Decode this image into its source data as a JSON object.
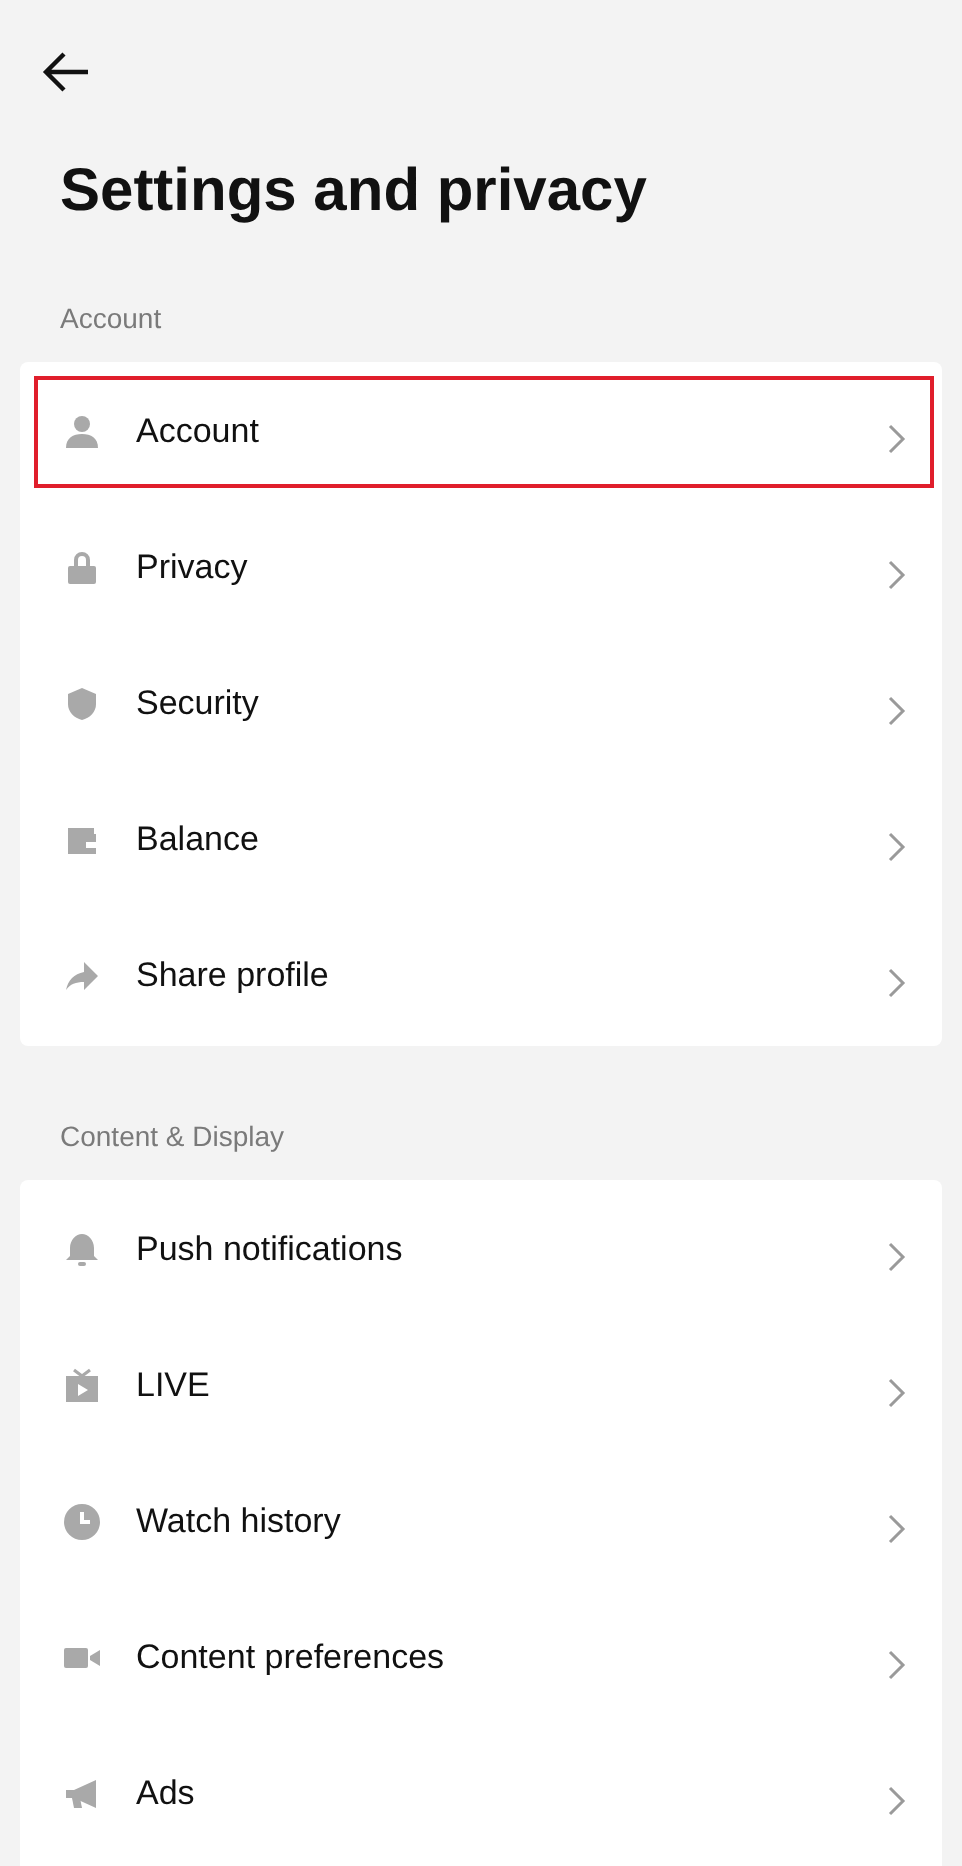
{
  "title": "Settings and privacy",
  "sections": [
    {
      "label": "Account",
      "items": [
        {
          "label": "Account",
          "highlighted": true
        },
        {
          "label": "Privacy",
          "highlighted": false
        },
        {
          "label": "Security",
          "highlighted": false
        },
        {
          "label": "Balance",
          "highlighted": false
        },
        {
          "label": "Share profile",
          "highlighted": false
        }
      ]
    },
    {
      "label": "Content & Display",
      "items": [
        {
          "label": "Push notifications",
          "highlighted": false
        },
        {
          "label": "LIVE",
          "highlighted": false
        },
        {
          "label": "Watch history",
          "highlighted": false
        },
        {
          "label": "Content preferences",
          "highlighted": false
        },
        {
          "label": "Ads",
          "highlighted": false
        }
      ]
    }
  ]
}
